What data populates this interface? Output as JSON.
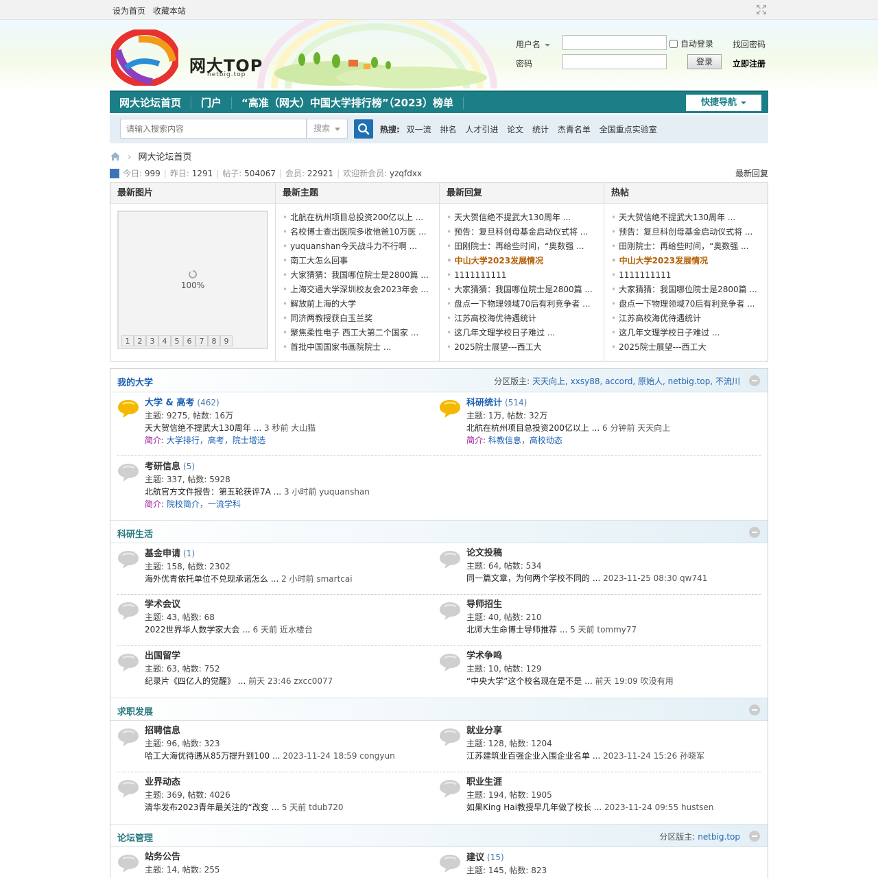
{
  "topbar": {
    "set_home": "设为首页",
    "bookmark": "收藏本站"
  },
  "header": {
    "logo_text": "网大TOP",
    "logo_sub": "netbig.top",
    "login": {
      "username_label": "用户名",
      "password_label": "密码",
      "username_value": "",
      "password_value": "",
      "auto_login": "自动登录",
      "forgot": "找回密码",
      "login_button": "登录",
      "register": "立即注册"
    }
  },
  "nav": {
    "items": [
      "网大论坛首页",
      "门户",
      "“高准（网大）中国大学排行榜”（2023）榜单"
    ],
    "quick_nav": "快捷导航"
  },
  "search": {
    "placeholder": "请输入搜索内容",
    "select": "搜索",
    "hot_label": "热搜:",
    "hot": [
      "双一流",
      "排名",
      "人才引进",
      "论文",
      "统计",
      "杰青名单",
      "全国重点实验室"
    ]
  },
  "breadcrumb": {
    "current": "网大论坛首页"
  },
  "stats": {
    "today_label": "今日:",
    "today": "999",
    "yesterday_label": "昨日:",
    "yesterday": "1291",
    "posts_label": "帖子:",
    "posts": "504067",
    "members_label": "会员:",
    "members": "22921",
    "new_label": "欢迎新会员:",
    "new_member": "yzqfdxx",
    "latest": "最新回复"
  },
  "portal": {
    "headers": [
      "最新图片",
      "最新主题",
      "最新回复",
      "热帖"
    ],
    "loading": "100%",
    "pages": [
      "1",
      "2",
      "3",
      "4",
      "5",
      "6",
      "7",
      "8",
      "9"
    ],
    "latest_topics": [
      "北航在杭州项目总投资200亿以上 ...",
      "名校博士查出医院多收他爸10万医 ...",
      "yuquanshan今天战斗力不行啊 ...",
      "南工大怎么回事",
      "大家猜猜：我国哪位院士是2800篇 ...",
      "上海交通大学深圳校友会2023年会 ...",
      "解放前上海的大学",
      "同济两教授获白玉兰奖",
      "聚焦柔性电子 西工大第二个国家 ...",
      "首批中国国家书画院院士 ..."
    ],
    "latest_replies": [
      "天大贺信绝不提武大130周年 ...",
      "预告：复旦科创母基金启动仪式将 ...",
      "田刚院士：再给些时间，“奥数强 ...",
      "中山大学2023发展情况",
      "1111111111",
      "大家猜猜：我国哪位院士是2800篇 ...",
      "盘点一下物理领域70后有利竞争者 ...",
      "江苏高校海优待遇统计",
      "这几年文理学校日子难过 ...",
      "2025院士展望---西工大"
    ],
    "hot_posts": [
      "天大贺信绝不提武大130周年 ...",
      "预告：复旦科创母基金启动仪式将 ...",
      "田刚院士：再给些时间，“奥数强 ...",
      "中山大学2023发展情况",
      "1111111111",
      "大家猜猜：我国哪位院士是2800篇 ...",
      "盘点一下物理领域70后有利竞争者 ...",
      "江苏高校海优待遇统计",
      "这几年文理学校日子难过 ...",
      "2025院士展望---西工大"
    ]
  },
  "groups": {
    "g1": {
      "title": "我的大学",
      "mods_label": "分区版主:",
      "mods": "天天向上, xxsy88, accord, 原始人, netbig.top, 不流川",
      "f1": {
        "name": "大学 & 高考",
        "count": "(462)",
        "stats": "主题: 9275, 帖数: 16万",
        "last": "天大贺信绝不提武大130周年 ...",
        "meta": "3 秒前 大山猫",
        "intro_label": "简介:",
        "intro": "大学排行，高考，院士增选"
      },
      "f2": {
        "name": "科研统计",
        "count": "(514)",
        "stats": "主题: 1万, 帖数: 32万",
        "last": "北航在杭州项目总投资200亿以上 ...",
        "meta": "6 分钟前 天天向上",
        "intro_label": "简介:",
        "intro": "科教信息，高校动态"
      },
      "f3": {
        "name": "考研信息",
        "count": "(5)",
        "stats": "主题: 337, 帖数: 5928",
        "last": "北航官方文件报告：第五轮获评7A ...",
        "meta": "3 小时前 yuquanshan",
        "intro_label": "简介:",
        "intro": "院校简介，一流学科"
      }
    },
    "g2": {
      "title": "科研生活",
      "f1": {
        "name": "基金申请",
        "count": "(1)",
        "stats": "主题: 158, 帖数: 2302",
        "last": "海外优青依托单位不兑现承诺怎么 ...",
        "meta": "2 小时前 smartcai"
      },
      "f2": {
        "name": "论文投稿",
        "count": "",
        "stats": "主题: 64, 帖数: 534",
        "last": "同一篇文章，为何两个学校不同的 ...",
        "meta": "2023-11-25 08:30 qw741"
      },
      "f3": {
        "name": "学术会议",
        "count": "",
        "stats": "主题: 43, 帖数: 68",
        "last": "2022世界华人数学家大会 ...",
        "meta": "6 天前 近水楼台"
      },
      "f4": {
        "name": "导师招生",
        "count": "",
        "stats": "主题: 40, 帖数: 210",
        "last": "北师大生命博士导师推荐 ...",
        "meta": "5 天前 tommy77"
      },
      "f5": {
        "name": "出国留学",
        "count": "",
        "stats": "主题: 63, 帖数: 752",
        "last": "纪录片《四亿人的觉醒》 ...",
        "meta": "前天 23:46 zxcc0077"
      },
      "f6": {
        "name": "学术争鸣",
        "count": "",
        "stats": "主题: 10, 帖数: 129",
        "last": "“中央大学”这个校名现在是不是 ...",
        "meta": "前天 19:09 吹没有用"
      }
    },
    "g3": {
      "title": "求职发展",
      "f1": {
        "name": "招聘信息",
        "stats": "主题: 96, 帖数: 323",
        "last": "哈工大海优待遇从85万提升到100 ...",
        "meta": "2023-11-24 18:59 congyun"
      },
      "f2": {
        "name": "就业分享",
        "stats": "主题: 128, 帖数: 1204",
        "last": "江苏建筑业百强企业入围企业名单 ...",
        "meta": "2023-11-24 15:26 孙晓军"
      },
      "f3": {
        "name": "业界动态",
        "stats": "主题: 369, 帖数: 4026",
        "last": "清华发布2023青年最关注的“改变 ...",
        "meta": "5 天前 tdub720"
      },
      "f4": {
        "name": "职业生涯",
        "stats": "主题: 194, 帖数: 1905",
        "last": "如果King Hai教授早几年做了校长 ...",
        "meta": "2023-11-24 09:55 hustsen"
      }
    },
    "g4": {
      "title": "论坛管理",
      "mods_label": "分区版主:",
      "mods": "netbig.top",
      "f1": {
        "name": "站务公告",
        "count": "",
        "stats": "主题: 14, 帖数: 255"
      },
      "f2": {
        "name": "建议",
        "count": "(15)",
        "stats": "主题: 145, 帖数: 823"
      }
    }
  },
  "colors": {
    "nav": "#1c7f87",
    "accent": "#1a5fb4",
    "highlight": "#b45f06"
  }
}
